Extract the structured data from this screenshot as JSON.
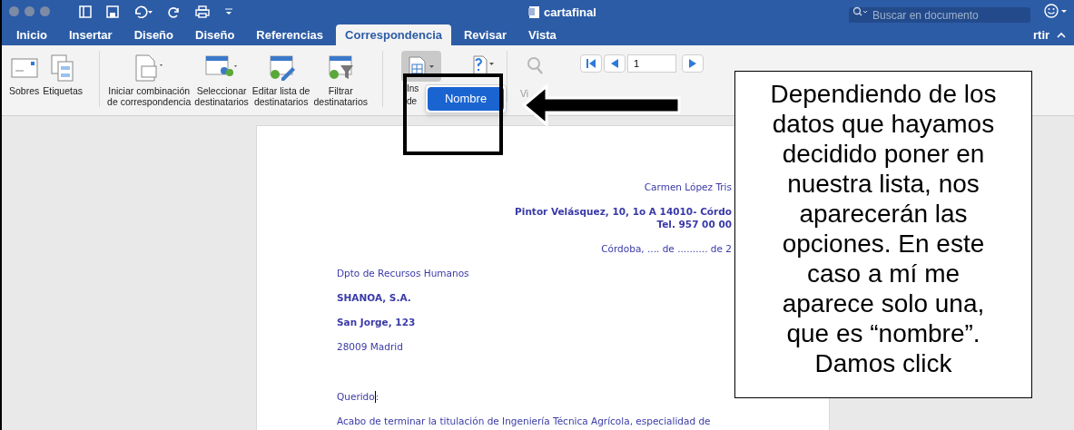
{
  "window": {
    "title": "cartafinal",
    "search": {
      "placeholder": "Buscar en documento"
    }
  },
  "tabs": [
    {
      "label": "Inicio",
      "selected": false
    },
    {
      "label": "Insertar",
      "selected": false
    },
    {
      "label": "Diseño",
      "selected": false
    },
    {
      "label": "Diseño",
      "selected": false
    },
    {
      "label": "Referencias",
      "selected": false
    },
    {
      "label": "Correspondencia",
      "selected": true
    },
    {
      "label": "Revisar",
      "selected": false
    },
    {
      "label": "Vista",
      "selected": false
    }
  ],
  "share": {
    "label": "rtir"
  },
  "ribbon": {
    "buttons": [
      {
        "kind": "envelope",
        "lines": [
          "Sobres"
        ]
      },
      {
        "kind": "labels",
        "lines": [
          "Etiquetas"
        ]
      },
      {
        "kind": "merge",
        "lines": [
          "Iniciar combinación",
          "de correspondencia"
        ]
      },
      {
        "kind": "select",
        "lines": [
          "Seleccionar",
          "destinatarios"
        ]
      },
      {
        "kind": "edit",
        "lines": [
          "Editar lista de",
          "destinatarios"
        ]
      },
      {
        "kind": "filter",
        "lines": [
          "Filtrar",
          "destinatarios"
        ]
      }
    ],
    "insert_field": {
      "lines": [
        "Ins",
        "de"
      ],
      "pressed": true
    },
    "preview": {
      "label": "Vi"
    },
    "record": {
      "value": "1"
    }
  },
  "dropdown": {
    "items": [
      {
        "label": "Nombre",
        "selected": true
      }
    ]
  },
  "document": {
    "blocks": [
      {
        "kind": "sender",
        "lines": [
          {
            "text": "Carmen López Tris",
            "bold": false
          }
        ]
      },
      {
        "kind": "sender",
        "lines": [
          {
            "text": "Pintor Velásquez, 10, 1o A 14010- Córdo",
            "bold": true
          },
          {
            "text": "Tel. 957 00 00",
            "bold": true
          }
        ]
      },
      {
        "kind": "sender",
        "lines": [
          {
            "text": "Córdoba, .... de .......... de 2",
            "bold": false
          }
        ]
      },
      {
        "kind": "body",
        "lines": [
          {
            "text": "Dpto de Recursos Humanos",
            "bold": false
          }
        ]
      },
      {
        "kind": "body",
        "lines": [
          {
            "text": "SHANOA, S.A.",
            "bold": true
          }
        ]
      },
      {
        "kind": "body",
        "lines": [
          {
            "text": "San Jorge, 123",
            "bold": true
          }
        ]
      },
      {
        "kind": "body",
        "lines": [
          {
            "text": "28009 Madrid",
            "bold": false
          }
        ]
      },
      {
        "kind": "body",
        "spaced": true,
        "lines": [
          {
            "text": "Querido ",
            "cursor": true,
            "after": ":",
            "bold": false
          }
        ]
      },
      {
        "kind": "body",
        "lines": [
          {
            "text": "Acabo de terminar la titulación de Ingeniería Técnica Agrícola, especialidad de",
            "bold": false
          }
        ]
      }
    ]
  },
  "callout": {
    "text": "Dependiendo de los datos que hayamos decidido poner en nuestra lista, nos aparecerán las opciones. En este caso a mí me aparece solo una, que es “nombre”. Damos click"
  }
}
